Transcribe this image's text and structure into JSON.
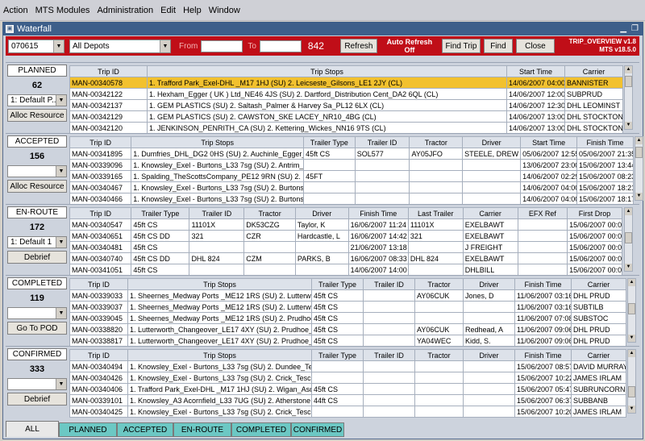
{
  "menu": [
    "Action",
    "MTS Modules",
    "Administration",
    "Edit",
    "Help",
    "Window"
  ],
  "window": {
    "title": "Waterfall"
  },
  "toolbar": {
    "date_value": "070615",
    "depot_value": "All Depots",
    "from_label": "From",
    "to_label": "To",
    "count": "842",
    "refresh_label": "Refresh",
    "auto_refresh_line1": "Auto Refresh",
    "auto_refresh_line2": "Off",
    "find_trip_label": "Find Trip",
    "find_label": "Find",
    "close_label": "Close",
    "version_line1": "TRIP_OVERVIEW v1.8",
    "version_line2": "MTS v18.5.0"
  },
  "planned": {
    "status": "PLANNED",
    "count": "62",
    "filter": "1: Default P...",
    "button": "Alloc Resource",
    "columns": [
      "Trip ID",
      "Trip Stops",
      "Start Time",
      "Carrier"
    ],
    "rows": [
      [
        "MAN-00340578",
        "1. Trafford Park_Exel-DHL _M17 1HJ (SU) 2. Leicseste_Gilsons_LE1 2JY (CL)",
        "14/06/2007 04:00",
        "BANNISTER"
      ],
      [
        "MAN-00342122",
        "1. Hexham_Egger ( UK ) Ltd_NE46 4JS (SU) 2. Dartford_Distribution Cent_DA2 6QL (CL)",
        "14/06/2007 12:00",
        "SUBPRUD"
      ],
      [
        "MAN-00342137",
        "1. GEM PLASTICS (SU) 2. Saltash_Palmer & Harvey Sa_PL12 6LX (CL)",
        "14/06/2007 12:30",
        "DHL LEOMINST"
      ],
      [
        "MAN-00342129",
        "1. GEM PLASTICS (SU) 2. CAWSTON_SKE LACEY_NR10_4BG (CL)",
        "14/06/2007 13:00",
        "DHL STOCKTON"
      ],
      [
        "MAN-00342120",
        "1. JENKINSON_PENRITH_CA (SU) 2. Kettering_Wickes_NN16 9TS (CL)",
        "14/06/2007 13:00",
        "DHL STOCKTON"
      ]
    ]
  },
  "accepted": {
    "status": "ACCEPTED",
    "count": "156",
    "button": "Alloc Resource",
    "columns": [
      "Trip ID",
      "Trip Stops",
      "Trailer Type",
      "Trailer ID",
      "Tractor",
      "Driver",
      "Start Time",
      "Finish Time"
    ],
    "rows": [
      [
        "MAN-00341895",
        "1. Dumfries_DHL_DG2 0HS (SU) 2. Auchinle_Egger_KA18",
        "45ft CS",
        "SOL577",
        "AY05JFO",
        "STEELE, DREW",
        "05/06/2007 12:55",
        "05/06/2007 21:35"
      ],
      [
        "MAN-00339096",
        "1. Knowsley_Exel - Burtons_L33 7sg (SU) 2. Antrim_Tesc",
        "",
        "",
        "",
        "",
        "13/06/2007 23:00",
        "15/06/2007 13:44"
      ],
      [
        "MAN-00339165",
        "1. Spalding_TheScottsCompany_PE12 9RN (SU) 2. Notting",
        "45FT",
        "",
        "",
        "",
        "14/06/2007 02:29",
        "15/06/2007 08:23"
      ],
      [
        "MAN-00340467",
        "1. Knowsley_Exel - Burtons_L33 7sg (SU) 2. Burtons_Llis",
        "",
        "",
        "",
        "",
        "14/06/2007 04:00",
        "15/06/2007 18:21"
      ],
      [
        "MAN-00340466",
        "1. Knowsley_Exel - Burtons_L33 7sg (SU) 2. Burtons_Llis",
        "",
        "",
        "",
        "",
        "14/06/2007 04:00",
        "15/06/2007 18:17"
      ]
    ]
  },
  "enroute": {
    "status": "EN-ROUTE",
    "count": "172",
    "filter": "1: Default 1",
    "button": "Debrief",
    "columns": [
      "Trip ID",
      "Trailer Type",
      "Trailer ID",
      "Tractor",
      "Driver",
      "Finish Time",
      "Last Trailer",
      "Carrier",
      "EFX Ref",
      "First Drop"
    ],
    "rows": [
      [
        "MAN-00340547",
        "45ft CS",
        "11101X",
        "DK53CZG",
        "Taylor, K",
        "16/06/2007 11:24",
        "11101X",
        "EXELBAWT",
        "",
        "15/06/2007 00:00"
      ],
      [
        "MAN-00340651",
        "45ft CS DD",
        "321",
        "CZR",
        "Hardcastle, L",
        "16/06/2007 14:42",
        "321",
        "EXELBAWT",
        "",
        "15/06/2007 00:00"
      ],
      [
        "MAN-00340481",
        "45ft CS",
        "",
        "",
        "",
        "21/06/2007 13:18",
        "",
        "J FREIGHT",
        "",
        "15/06/2007 00:00"
      ],
      [
        "MAN-00340740",
        "45ft CS DD",
        "DHL 824",
        "CZM",
        "PARKS, B",
        "16/06/2007 08:33",
        "DHL 824",
        "EXELBAWT",
        "",
        "15/06/2007 00:00"
      ],
      [
        "MAN-00341051",
        "45ft CS",
        "",
        "",
        "",
        "14/06/2007 14:00",
        "",
        "DHLBILL",
        "",
        "15/06/2007 00:00"
      ]
    ]
  },
  "completed": {
    "status": "COMPLETED",
    "count": "119",
    "button": "Go To POD",
    "columns": [
      "Trip ID",
      "Trip Stops",
      "Trailer Type",
      "Trailer ID",
      "Tractor",
      "Driver",
      "Finish Time",
      "Carrier"
    ],
    "rows": [
      [
        "MAN-00339033",
        "1. Sheernes_Medway Ports _ME12 1RS (SU) 2. Lutterwo",
        "45ft CS",
        "",
        "AY06CUK",
        "Jones, D",
        "11/06/2007 03:16",
        "DHL PRUD"
      ],
      [
        "MAN-00339037",
        "1. Sheernes_Medway Ports _ME12 1RS (SU) 2. Lutterwo",
        "45ft CS",
        "",
        "",
        "",
        "11/06/2007 03:16",
        "SUBTILB"
      ],
      [
        "MAN-00339045",
        "1. Sheernes_Medway Ports _ME12 1RS (SU) 2. Prudhoe_",
        "45ft CS",
        "",
        "",
        "",
        "11/06/2007 07:08",
        "SUBSTOC"
      ],
      [
        "MAN-00338820",
        "1. Lutterworth_Changeover_LE17 4XY (SU) 2. Prudhoe_S",
        "45ft CS",
        "",
        "AY06CUK",
        "Redhead, A",
        "11/06/2007 09:06",
        "DHL PRUD"
      ],
      [
        "MAN-00338817",
        "1. Lutterworth_Changeover_LE17 4XY (SU) 2. Prudhoe_S",
        "45ft CS",
        "",
        "YA04WEC",
        "Kidd, S.",
        "11/06/2007 09:06",
        "DHL PRUD"
      ]
    ]
  },
  "confirmed": {
    "status": "CONFIRMED",
    "count": "333",
    "button": "Debrief",
    "columns": [
      "Trip ID",
      "Trip Stops",
      "Trailer Type",
      "Trailer ID",
      "Tractor",
      "Driver",
      "Finish Time",
      "Carrier"
    ],
    "rows": [
      [
        "MAN-00340494",
        "1. Knowsley_Exel - Burtons_L33 7sg (SU) 2. Dundee_Te:",
        "",
        "",
        "",
        "",
        "15/06/2007 08:57",
        "DAVID MURRAY"
      ],
      [
        "MAN-00340426",
        "1. Knowsley_Exel - Burtons_L33 7sg (SU) 2. Crick_Tesco",
        "",
        "",
        "",
        "",
        "15/06/2007 10:22",
        "JAMES IRLAM"
      ],
      [
        "MAN-00340406",
        "1. Trafford Park_Exel-DHL _M17 1HJ (SU) 2. Wigan_Asda",
        "45ft CS",
        "",
        "",
        "",
        "15/06/2007 05:47",
        "SUBRUNCORN"
      ],
      [
        "MAN-00339101",
        "1. Knowsley_A3 Acornfield_L33 7UG (SU) 2. Atherstone",
        "44ft CS",
        "",
        "",
        "",
        "15/06/2007 06:37",
        "SUBBANB"
      ],
      [
        "MAN-00340425",
        "1. Knowsley_Exel - Burtons_L33 7sg (SU) 2. Crick_Tesco",
        "",
        "",
        "",
        "",
        "15/06/2007 10:20",
        "JAMES IRLAM"
      ]
    ]
  },
  "tabs": [
    "ALL",
    "PLANNED",
    "ACCEPTED",
    "EN-ROUTE",
    "COMPLETED",
    "CONFIRMED"
  ],
  "colors": {
    "header_red": "#c00e18",
    "selected_row": "#f2c12e",
    "tab_teal": "#6cc8c4",
    "title_blue": "#3e5f8a"
  }
}
